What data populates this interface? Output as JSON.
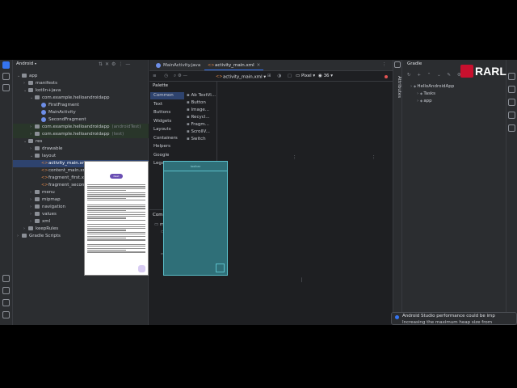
{
  "logo": {
    "text": "RARL"
  },
  "project": {
    "view_label": "Android",
    "tree": [
      {
        "label": "app",
        "kind": "folder",
        "level": 0,
        "open": true
      },
      {
        "label": "manifests",
        "kind": "folder",
        "level": 1
      },
      {
        "label": "kotlin+java",
        "kind": "folder",
        "level": 1,
        "open": true
      },
      {
        "label": "com.example.helloandroidapp",
        "kind": "folder",
        "level": 2,
        "open": true
      },
      {
        "label": "FirstFragment",
        "kind": "kt",
        "level": 3
      },
      {
        "label": "MainActivity",
        "kind": "kt",
        "level": 3
      },
      {
        "label": "SecondFragment",
        "kind": "kt",
        "level": 3
      },
      {
        "label": "com.example.helloandroidapp",
        "suffix": "(androidTest)",
        "kind": "folder",
        "level": 2,
        "state": "mod"
      },
      {
        "label": "com.example.helloandroidapp",
        "suffix": "(test)",
        "kind": "folder",
        "level": 2,
        "state": "mod"
      },
      {
        "label": "res",
        "kind": "folder",
        "level": 1,
        "open": true
      },
      {
        "label": "drawable",
        "kind": "folder",
        "level": 2
      },
      {
        "label": "layout",
        "kind": "folder",
        "level": 2,
        "open": true
      },
      {
        "label": "activity_main.xml",
        "kind": "xml",
        "level": 3,
        "state": "sel"
      },
      {
        "label": "content_main.xml",
        "kind": "xml",
        "level": 3
      },
      {
        "label": "fragment_first.xml",
        "kind": "xml",
        "level": 3
      },
      {
        "label": "fragment_second.xml",
        "kind": "xml",
        "level": 3
      },
      {
        "label": "menu",
        "kind": "folder",
        "level": 2
      },
      {
        "label": "mipmap",
        "kind": "folder",
        "level": 2
      },
      {
        "label": "navigation",
        "kind": "folder",
        "level": 2
      },
      {
        "label": "values",
        "kind": "folder",
        "level": 2
      },
      {
        "label": "xml",
        "kind": "folder",
        "level": 2
      },
      {
        "label": "keepRules",
        "kind": "folder",
        "level": 1
      },
      {
        "label": "Gradle Scripts",
        "kind": "folder",
        "level": 0
      }
    ]
  },
  "editor": {
    "tabs": [
      {
        "label": "MainActivity.java",
        "active": false
      },
      {
        "label": "activity_main.xml",
        "active": true
      }
    ],
    "toolbar": {
      "file": "activity_main.xml",
      "device": "Pixel",
      "api": "36"
    },
    "palette": {
      "title": "Palette",
      "categories": [
        "Common",
        "Text",
        "Buttons",
        "Widgets",
        "Layouts",
        "Containers",
        "Helpers",
        "Google",
        "Legacy"
      ],
      "selected_category": "Common",
      "items": [
        "Ab TextVi...",
        "Button",
        "Image...",
        "Recycl...",
        "Fragm...",
        "ScrollV...",
        "Switch"
      ]
    },
    "component_tree": {
      "title": "Component Tree",
      "rows": [
        {
          "label": "main",
          "hint": ""
        },
        {
          "label": "AppBarLayout",
          "hint": ""
        },
        {
          "label": "toolbar",
          "hint": ""
        },
        {
          "label": "<include/>",
          "hint": "@layout/..."
        },
        {
          "label": "fab",
          "hint": ""
        }
      ]
    },
    "preview": {
      "button_label": "Next",
      "blueprint_label": "toolbar"
    }
  },
  "attributes_label": "Attributes",
  "gradle": {
    "title": "Gradle",
    "rows": [
      {
        "label": "HelloAndroidApp",
        "level": 0
      },
      {
        "label": "Tasks",
        "level": 1
      },
      {
        "label": "app",
        "level": 1
      }
    ]
  },
  "notification": {
    "title": "Android Studio performance could be imp",
    "body": "Increasing the maximum heap size from"
  },
  "colors": {
    "accent": "#3574f0",
    "selection": "#2e436e",
    "blueprint": "#2f6f78",
    "error": "#e55454"
  }
}
